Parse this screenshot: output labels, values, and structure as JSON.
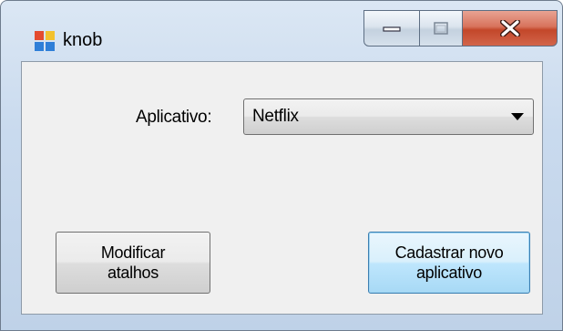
{
  "window": {
    "title": "knob"
  },
  "form": {
    "app_label": "Aplicativo:",
    "app_selected": "Netflix"
  },
  "buttons": {
    "modify_label": "Modificar atalhos",
    "register_label": "Cadastrar novo aplicativo"
  },
  "icons": {
    "app": "app-window-icon",
    "minimize": "minimize-icon",
    "maximize": "maximize-icon",
    "close": "close-icon",
    "dropdown": "chevron-down-icon"
  },
  "colors": {
    "client_bg": "#f0f0f0",
    "close_red": "#c3472a",
    "focus_blue": "#3c7fb1"
  }
}
